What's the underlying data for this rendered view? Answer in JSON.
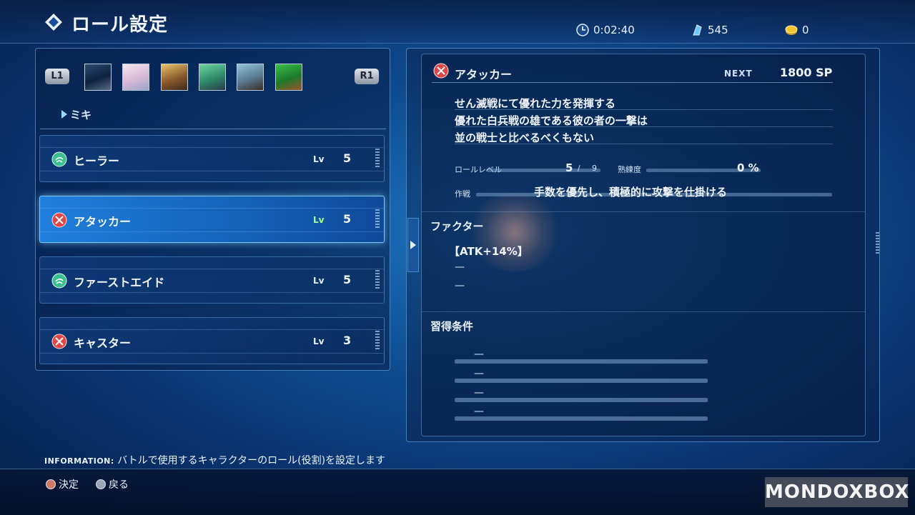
{
  "header": {
    "title": "ロール設定",
    "play_time": "0:02:40",
    "crystals": "545",
    "coins": "0"
  },
  "left_panel": {
    "l1_label": "L1",
    "r1_label": "R1",
    "character_name": "ミキ",
    "roles": [
      {
        "name": "ヒーラー",
        "lv_label": "Lv",
        "level": "5",
        "icon": "healer-icon",
        "color": "#3bbf8e"
      },
      {
        "name": "アタッカー",
        "lv_label": "Lv",
        "level": "5",
        "icon": "attacker-icon",
        "color": "#e04848"
      },
      {
        "name": "ファーストエイド",
        "lv_label": "Lv",
        "level": "5",
        "icon": "first-aid-icon",
        "color": "#3bbf8e"
      },
      {
        "name": "キャスター",
        "lv_label": "Lv",
        "level": "3",
        "icon": "caster-icon",
        "color": "#e04848"
      }
    ]
  },
  "detail": {
    "role_name": "アタッカー",
    "next_label": "NEXT",
    "next_value": "1800 SP",
    "description": [
      "せん滅戦にて優れた力を発揮する",
      "優れた白兵戦の雄である彼の者の一撃は",
      "並の戦士と比べるべくもない"
    ],
    "role_level_label": "ロールレベル",
    "role_level_value": "5",
    "role_level_sep": "/",
    "role_level_max": "9",
    "proficiency_label": "熟練度",
    "proficiency_value": "0 %",
    "proficiency_fraction": 0,
    "tactics_label": "作戦",
    "tactics_value": "手数を優先し、積極的に攻撃を仕掛ける",
    "factor_title": "ファクター",
    "factors": [
      "【ATK+14%】",
      "—",
      "—"
    ],
    "requirements_title": "習得条件",
    "requirements": [
      "—",
      "—",
      "—",
      "—"
    ]
  },
  "footer": {
    "info_label": "INFORMATION:",
    "info_text": "バトルで使用するキャラクターのロール(役割)を設定します",
    "confirm_label": "決定",
    "back_label": "戻る"
  },
  "watermark": "MONDOXBOX"
}
